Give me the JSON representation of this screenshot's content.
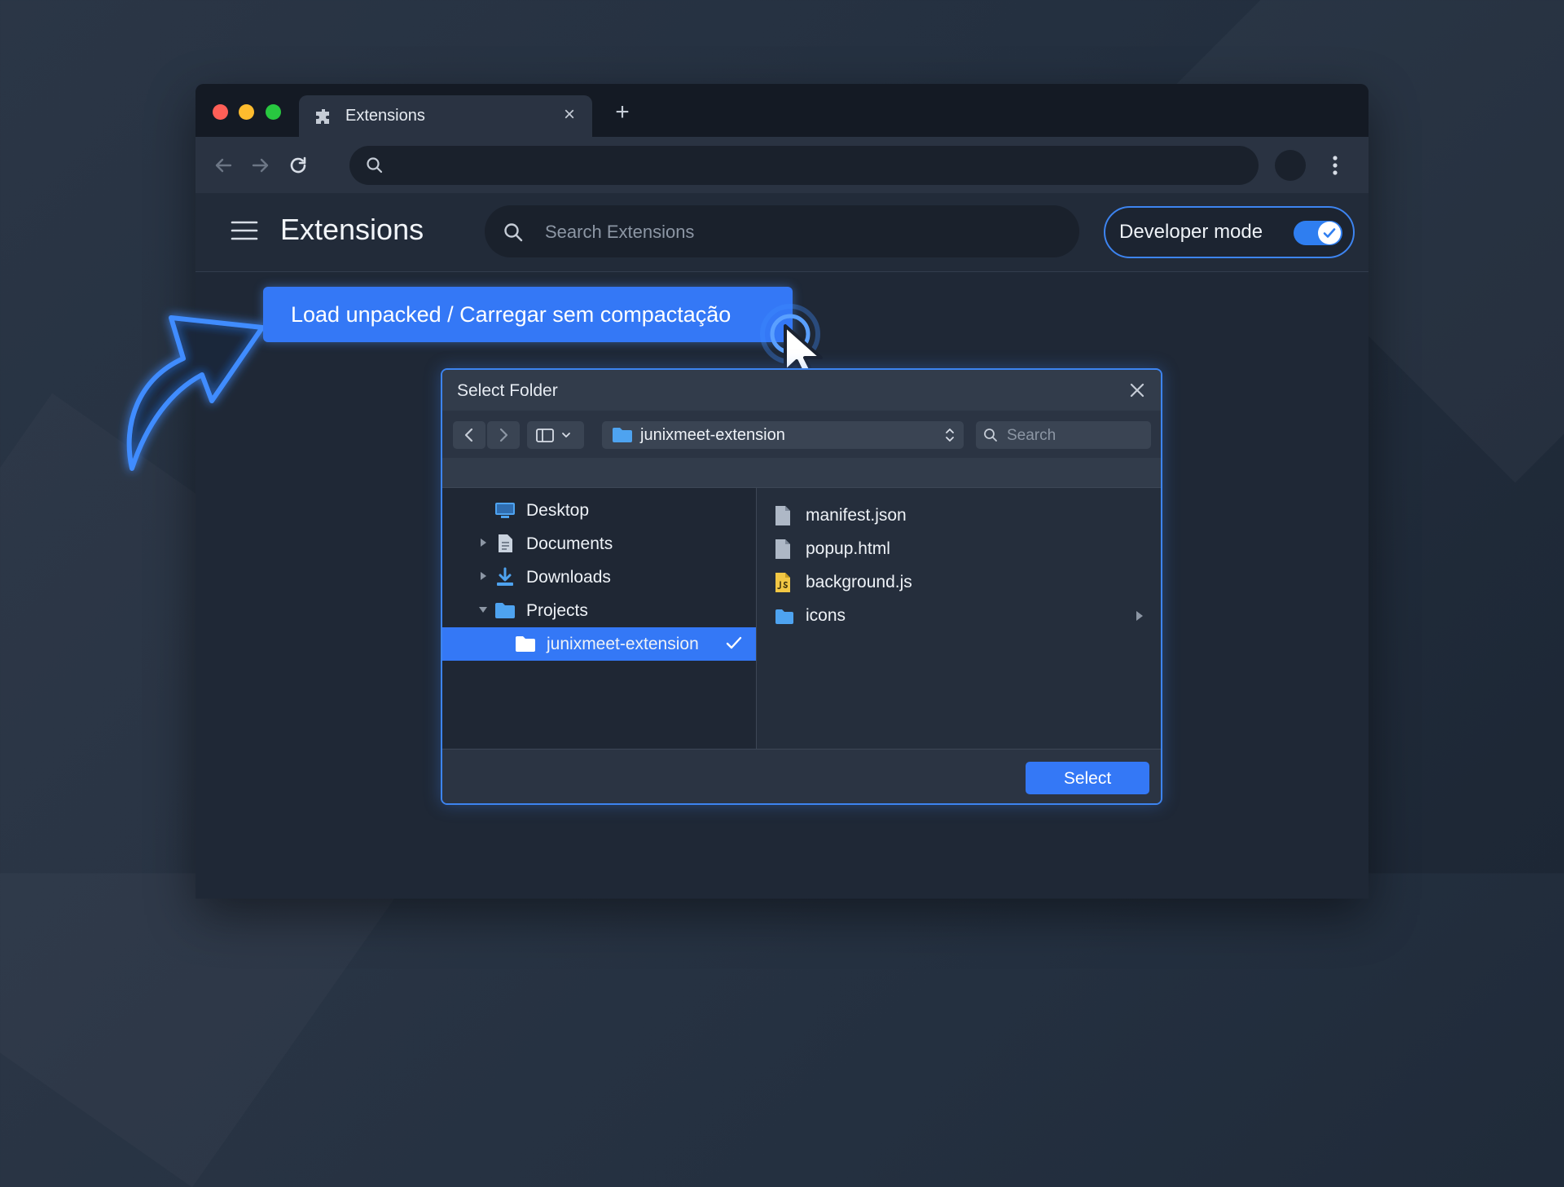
{
  "browser": {
    "tab": {
      "title": "Extensions",
      "icon": "puzzle-icon",
      "close": "×"
    },
    "new_tab": "+",
    "omnibox": {
      "value": "",
      "placeholder": ""
    }
  },
  "extensions_page": {
    "title": "Extensions",
    "search_placeholder": "Search Extensions",
    "developer_mode": {
      "label": "Developer mode",
      "enabled": true
    }
  },
  "load_unpacked": {
    "label": "Load unpacked / Carregar sem compactação"
  },
  "dialog": {
    "title": "Select Folder",
    "path": "junixmeet-extension",
    "search_placeholder": "Search",
    "sidebar": [
      {
        "label": "Desktop",
        "icon": "desktop-icon",
        "expandable": false,
        "expanded": false,
        "selected": false
      },
      {
        "label": "Documents",
        "icon": "document-icon",
        "expandable": true,
        "expanded": false,
        "selected": false
      },
      {
        "label": "Downloads",
        "icon": "download-icon",
        "expandable": true,
        "expanded": false,
        "selected": false
      },
      {
        "label": "Projects",
        "icon": "folder-icon",
        "expandable": true,
        "expanded": true,
        "selected": false
      },
      {
        "label": "junixmeet-extension",
        "icon": "folder-icon",
        "expandable": false,
        "expanded": false,
        "selected": true
      }
    ],
    "files": [
      {
        "name": "manifest.json",
        "icon": "file-icon"
      },
      {
        "name": "popup.html",
        "icon": "file-icon"
      },
      {
        "name": "background.js",
        "icon": "js-file-icon"
      },
      {
        "name": "icons",
        "icon": "folder-icon",
        "has_children": true
      }
    ],
    "select_button": "Select"
  },
  "colors": {
    "accent": "#3478f6",
    "background": "#243040",
    "dialog": "#252e3c"
  }
}
